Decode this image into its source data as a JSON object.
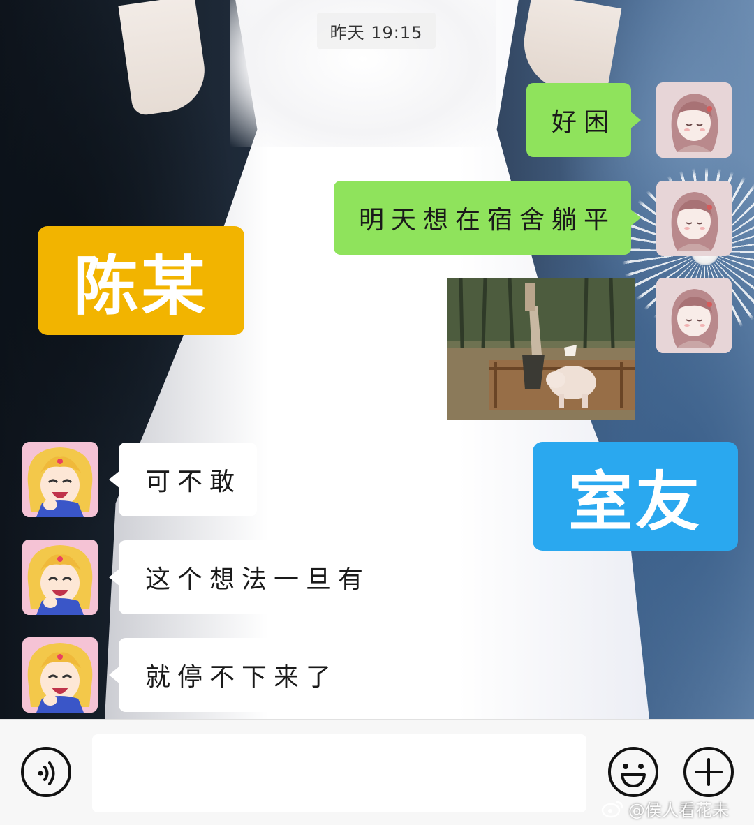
{
  "chat": {
    "timestamp": "昨天 19:15",
    "messages": [
      {
        "side": "out",
        "type": "text",
        "text": "好困"
      },
      {
        "side": "out",
        "type": "text",
        "text": "明天想在宿舍躺平"
      },
      {
        "side": "out",
        "type": "image",
        "text": ""
      },
      {
        "side": "in",
        "type": "text",
        "text": "可不敢"
      },
      {
        "side": "in",
        "type": "text",
        "text": "这个想法一旦有"
      },
      {
        "side": "in",
        "type": "text",
        "text": "就停不下来了"
      }
    ]
  },
  "labels": {
    "left_contact": "陈某",
    "right_contact": "室友"
  },
  "input_bar": {
    "value": "",
    "placeholder": "",
    "voice_icon": "voice-icon",
    "emoji_icon": "emoji-icon",
    "plus_icon": "plus-icon"
  },
  "watermark": {
    "text": "@侯人看花未",
    "icon": "weibo-icon"
  },
  "colors": {
    "outgoing_bubble": "#8fe35c",
    "incoming_bubble": "#ffffff",
    "label_left": "#f2b400",
    "label_right": "#2aa8ef"
  }
}
